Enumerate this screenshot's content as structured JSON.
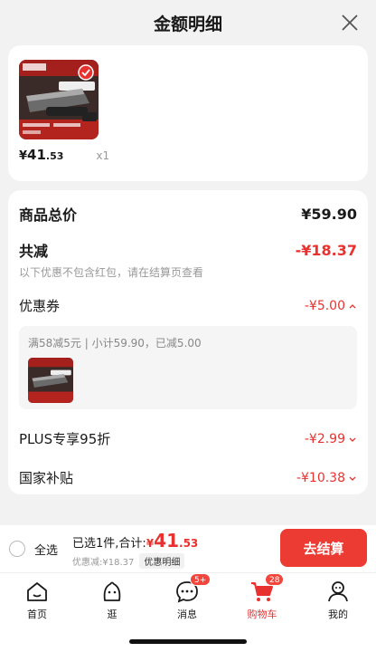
{
  "header": {
    "title": "金额明细"
  },
  "product": {
    "price_sym": "¥",
    "price_int": "41",
    "price_dec": ".53",
    "quantity": "x1"
  },
  "details": {
    "total_label": "商品总价",
    "total_value": "¥59.90",
    "reduce_label": "共减",
    "reduce_value": "-¥18.37",
    "reduce_note": "以下优惠不包含红包，请在结算页查看",
    "coupon_label": "优惠券",
    "coupon_value": "-¥5.00",
    "coupon_desc": "满58减5元 | 小计59.90，已减5.00",
    "plus_label": "PLUS专享95折",
    "plus_value": "-¥2.99",
    "subsidy_label": "国家补贴",
    "subsidy_value": "-¥10.38"
  },
  "bottom": {
    "select_all": "全选",
    "selected_text": "已选1件,合计:",
    "price_sym": "¥",
    "price_int": "41",
    "price_dec": ".53",
    "discount_text": "优惠减:¥18.37",
    "detail_chip": "优惠明细",
    "checkout": "去结算"
  },
  "tabs": [
    {
      "label": "首页"
    },
    {
      "label": "逛"
    },
    {
      "label": "消息",
      "badge": "5+"
    },
    {
      "label": "购物车",
      "badge": "28"
    },
    {
      "label": "我的"
    }
  ],
  "colors": {
    "accent": "#e8322f",
    "checkout": "#ec3b32"
  }
}
